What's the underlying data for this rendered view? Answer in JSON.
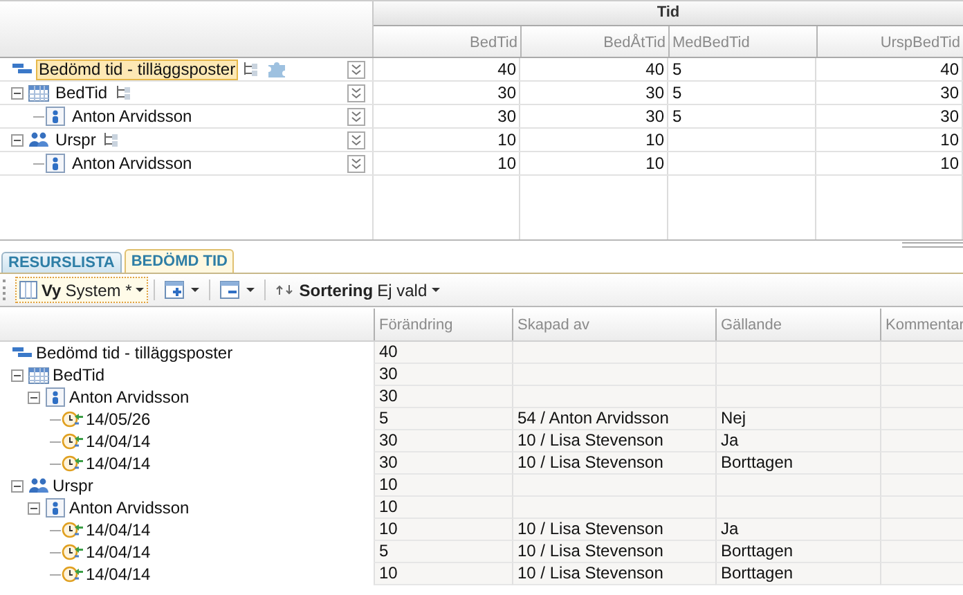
{
  "top_grid": {
    "group_header": "Tid",
    "columns": [
      "BedTid",
      "BedÅtTid",
      "MedBedTid",
      "UrspBedTid"
    ],
    "rows": [
      {
        "kind": "group",
        "label": "Bedömd tid - tilläggsposter",
        "selected": true,
        "hierarchy_badge": true,
        "puzzle_badge": true,
        "bed_tid": "40",
        "bed_at_tid": "40",
        "med_bed_tid": "5",
        "ursp_bed_tid": "40",
        "children": [
          {
            "kind": "table",
            "label": "BedTid",
            "selected": false,
            "expanded": true,
            "hierarchy_badge": true,
            "bed_tid": "30",
            "bed_at_tid": "30",
            "med_bed_tid": "5",
            "ursp_bed_tid": "30",
            "children": [
              {
                "kind": "person",
                "label": "Anton Arvidsson",
                "selected": false,
                "bed_tid": "30",
                "bed_at_tid": "30",
                "med_bed_tid": "5",
                "ursp_bed_tid": "30"
              }
            ]
          },
          {
            "kind": "people",
            "label": "Urspr",
            "selected": false,
            "expanded": true,
            "hierarchy_badge": true,
            "bed_tid": "10",
            "bed_at_tid": "10",
            "ursp_bed_tid": "10",
            "children": [
              {
                "kind": "person",
                "label": "Anton Arvidsson",
                "selected": false,
                "bed_tid": "10",
                "bed_at_tid": "10",
                "ursp_bed_tid": "10"
              }
            ]
          }
        ]
      }
    ]
  },
  "tabs": [
    {
      "label": "RESURSLISTA",
      "selected": false
    },
    {
      "label": "BEDÖMD TID",
      "selected": true
    }
  ],
  "toolbar": {
    "view": {
      "label": "Vy",
      "value": "System *"
    },
    "sort": {
      "label": "Sortering",
      "value": "Ej vald"
    }
  },
  "bottom_grid": {
    "columns": [
      "Förändring",
      "Skapad av",
      "Gällande",
      "Kommentar"
    ],
    "rows": [
      {
        "kind": "group",
        "label": "Bedömd tid - tilläggsposter",
        "forandring": "40",
        "children": [
          {
            "kind": "table",
            "label": "BedTid",
            "expanded": true,
            "forandring": "30",
            "children": [
              {
                "kind": "person",
                "label": "Anton Arvidsson",
                "expanded": true,
                "forandring": "30",
                "children": [
                  {
                    "kind": "history",
                    "label": "14/05/26",
                    "forandring": "5",
                    "skapad_av": "54 / Anton Arvidsson",
                    "gallande": "Nej"
                  },
                  {
                    "kind": "history",
                    "label": "14/04/14",
                    "forandring": "30",
                    "skapad_av": "10 / Lisa Stevenson",
                    "gallande": "Ja"
                  },
                  {
                    "kind": "history",
                    "label": "14/04/14",
                    "forandring": "30",
                    "skapad_av": "10 / Lisa Stevenson",
                    "gallande": "Borttagen"
                  }
                ]
              }
            ]
          },
          {
            "kind": "people",
            "label": "Urspr",
            "expanded": true,
            "forandring": "10",
            "children": [
              {
                "kind": "person",
                "label": "Anton Arvidsson",
                "expanded": true,
                "forandring": "10",
                "children": [
                  {
                    "kind": "history",
                    "label": "14/04/14",
                    "forandring": "10",
                    "skapad_av": "10 / Lisa Stevenson",
                    "gallande": "Ja"
                  },
                  {
                    "kind": "history",
                    "label": "14/04/14",
                    "forandring": "5",
                    "skapad_av": "10 / Lisa Stevenson",
                    "gallande": "Borttagen"
                  },
                  {
                    "kind": "history",
                    "label": "14/04/14",
                    "forandring": "10",
                    "skapad_av": "10 / Lisa Stevenson",
                    "gallande": "Borttagen"
                  }
                ]
              }
            ]
          }
        ]
      }
    ]
  }
}
